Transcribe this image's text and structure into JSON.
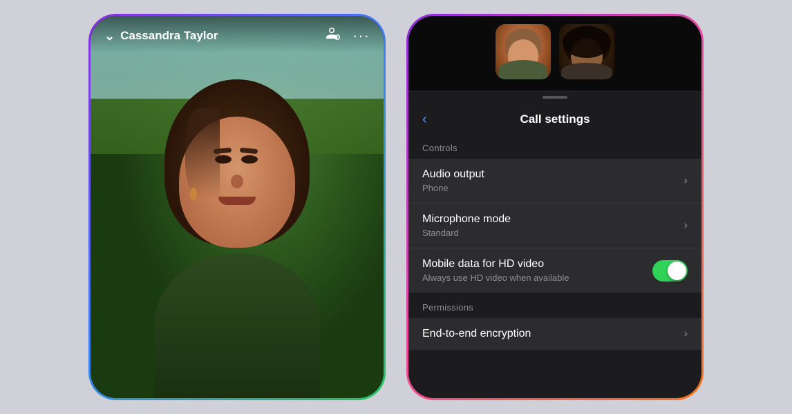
{
  "left_phone": {
    "caller_name": "Cassandra Taylor",
    "chevron": "⌄",
    "add_person_icon": "person-badge-plus",
    "more_icon": "ellipsis"
  },
  "right_phone": {
    "settings_title": "Call settings",
    "back_label": "‹",
    "sections": {
      "controls_label": "Controls",
      "permissions_label": "Permissions"
    },
    "items": [
      {
        "title": "Audio output",
        "subtitle": "Phone",
        "type": "nav"
      },
      {
        "title": "Microphone mode",
        "subtitle": "Standard",
        "type": "nav"
      },
      {
        "title": "Mobile data for HD video",
        "subtitle": "Always use HD video when available",
        "type": "toggle",
        "enabled": true
      }
    ],
    "permission_items": [
      {
        "title": "End-to-end encryption",
        "type": "nav"
      }
    ]
  }
}
